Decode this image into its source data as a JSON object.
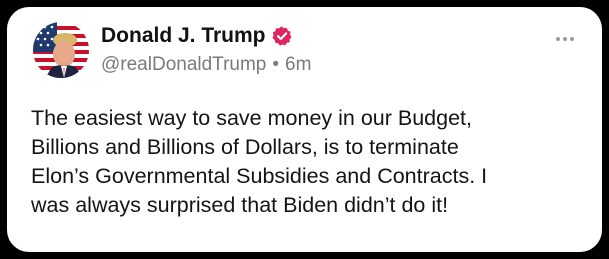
{
  "post": {
    "author": {
      "display_name": "Donald J. Trump",
      "handle": "@realDonaldTrump",
      "verified": true,
      "verified_color": "#e0245e"
    },
    "separator": "•",
    "timestamp": "6m",
    "more_icon": "more-horizontal-icon",
    "body_lines": [
      "The easiest way to save money in our Budget,",
      "Billions and Billions of Dollars, is to terminate",
      "Elon’s Governmental Subsidies and Contracts. I",
      "was always surprised that Biden didn’t do it!"
    ]
  }
}
